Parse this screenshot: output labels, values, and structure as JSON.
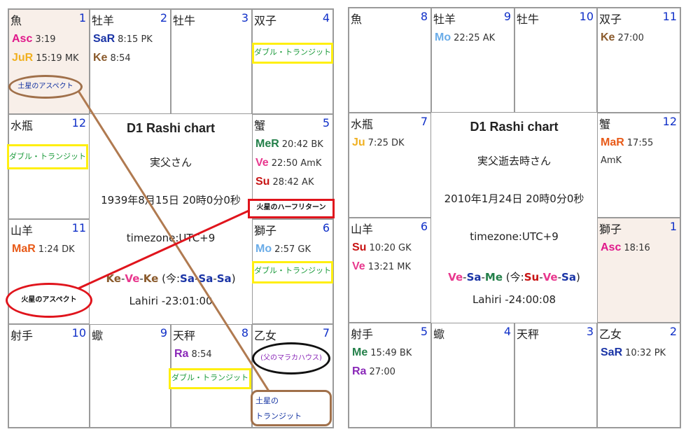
{
  "colors": {
    "Asc": "#e0178a",
    "Ju": "#f0b020",
    "JuR": "#f0b020",
    "Sa": "#1a34a6",
    "SaR": "#1a34a6",
    "Ke": "#8a5a2c",
    "Me": "#24804a",
    "MeR": "#24804a",
    "Ve": "#e8388e",
    "Su": "#c81414",
    "Ma": "#e85a18",
    "MaR": "#e85a18",
    "Mo": "#6aace8",
    "Ra": "#8a28b8"
  },
  "chart1": {
    "cells": [
      {
        "sign": "魚",
        "house": "1",
        "planets": [
          {
            "abbr": "Asc",
            "deg": "3:19"
          },
          {
            "abbr": "JuR",
            "deg": "15:19 MK"
          }
        ]
      },
      {
        "sign": "牡羊",
        "house": "2",
        "planets": [
          {
            "abbr": "SaR",
            "deg": "8:15 PK"
          },
          {
            "abbr": "Ke",
            "deg": "8:54"
          }
        ]
      },
      {
        "sign": "牡牛",
        "house": "3",
        "planets": []
      },
      {
        "sign": "双子",
        "house": "4",
        "planets": []
      },
      {
        "sign": "水瓶",
        "house": "12",
        "planets": []
      },
      {
        "sign": "蟹",
        "house": "5",
        "planets": [
          {
            "abbr": "MeR",
            "deg": "20:42 BK"
          },
          {
            "abbr": "Ve",
            "deg": "22:50 AmK"
          },
          {
            "abbr": "Su",
            "deg": "28:42 AK"
          }
        ]
      },
      {
        "sign": "山羊",
        "house": "11",
        "planets": [
          {
            "abbr": "MaR",
            "deg": "1:24 DK"
          }
        ]
      },
      {
        "sign": "獅子",
        "house": "6",
        "planets": [
          {
            "abbr": "Mo",
            "deg": "2:57 GK"
          }
        ]
      },
      {
        "sign": "射手",
        "house": "10",
        "planets": []
      },
      {
        "sign": "蠍",
        "house": "9",
        "planets": []
      },
      {
        "sign": "天秤",
        "house": "8",
        "planets": [
          {
            "abbr": "Ra",
            "deg": "8:54"
          }
        ]
      },
      {
        "sign": "乙女",
        "house": "7",
        "planets": []
      }
    ],
    "center": {
      "title": "D1 Rashi chart",
      "name": "実父さん",
      "datetime": "1939年8月15日 20時0分0秒",
      "timezone": "timezone:UTC+9",
      "dasha": [
        {
          "p": "Ke",
          "c": "Ke"
        },
        {
          "p": "-",
          "c": "dash"
        },
        {
          "p": "Ve",
          "c": "Ve"
        },
        {
          "p": "-",
          "c": "dash"
        },
        {
          "p": "Ke",
          "c": "Ke"
        }
      ],
      "dasha_now_prefix": " (今:",
      "dasha_now": [
        {
          "p": "Sa",
          "c": "Sa"
        },
        {
          "p": "-",
          "c": "dash"
        },
        {
          "p": "Sa",
          "c": "Sa"
        },
        {
          "p": "-",
          "c": "dash"
        },
        {
          "p": "Sa",
          "c": "Sa"
        }
      ],
      "dasha_now_suffix": ")",
      "ayanamsa": "Lahiri -23:01:00"
    }
  },
  "chart2": {
    "cells": [
      {
        "sign": "魚",
        "house": "8",
        "planets": []
      },
      {
        "sign": "牡羊",
        "house": "9",
        "planets": [
          {
            "abbr": "Mo",
            "deg": "22:25 AK"
          }
        ]
      },
      {
        "sign": "牡牛",
        "house": "10",
        "planets": []
      },
      {
        "sign": "双子",
        "house": "11",
        "planets": [
          {
            "abbr": "Ke",
            "deg": "27:00"
          }
        ]
      },
      {
        "sign": "水瓶",
        "house": "7",
        "planets": [
          {
            "abbr": "Ju",
            "deg": "7:25 DK"
          }
        ]
      },
      {
        "sign": "蟹",
        "house": "12",
        "planets": [
          {
            "abbr": "MaR",
            "deg": "17:55"
          }
        ],
        "extra": "AmK"
      },
      {
        "sign": "山羊",
        "house": "6",
        "planets": [
          {
            "abbr": "Su",
            "deg": "10:20 GK"
          },
          {
            "abbr": "Ve",
            "deg": "13:21 MK"
          }
        ]
      },
      {
        "sign": "獅子",
        "house": "1",
        "planets": [
          {
            "abbr": "Asc",
            "deg": "18:16"
          }
        ]
      },
      {
        "sign": "射手",
        "house": "5",
        "planets": [
          {
            "abbr": "Me",
            "deg": "15:49 BK"
          },
          {
            "abbr": "Ra",
            "deg": "27:00"
          }
        ]
      },
      {
        "sign": "蠍",
        "house": "4",
        "planets": []
      },
      {
        "sign": "天秤",
        "house": "3",
        "planets": []
      },
      {
        "sign": "乙女",
        "house": "2",
        "planets": [
          {
            "abbr": "SaR",
            "deg": "10:32 PK"
          }
        ]
      }
    ],
    "center": {
      "title": "D1 Rashi chart",
      "name": "実父逝去時さん",
      "datetime": "2010年1月24日 20時0分0秒",
      "timezone": "timezone:UTC+9",
      "dasha": [
        {
          "p": "Ve",
          "c": "Ve"
        },
        {
          "p": "-",
          "c": "dash"
        },
        {
          "p": "Sa",
          "c": "Sa"
        },
        {
          "p": "-",
          "c": "dash"
        },
        {
          "p": "Me",
          "c": "Me"
        }
      ],
      "dasha_now_prefix": " (今:",
      "dasha_now": [
        {
          "p": "Su",
          "c": "Su"
        },
        {
          "p": "-",
          "c": "dash"
        },
        {
          "p": "Ve",
          "c": "Ve"
        },
        {
          "p": "-",
          "c": "dash"
        },
        {
          "p": "Sa",
          "c": "Sa"
        }
      ],
      "dasha_now_suffix": ")",
      "ayanamsa": "Lahiri -24:00:08"
    }
  },
  "annotations": {
    "saturn_aspect": "土星のアスペクト",
    "double_transit": "ダブル・トランジット",
    "mars_half_return": "火星のハーフリターン",
    "mars_aspect": "火星のアスペクト",
    "father_maraka": "(父のマラカハウス)",
    "saturn_transit_1": "土星の",
    "saturn_transit_2": "トランジット"
  }
}
